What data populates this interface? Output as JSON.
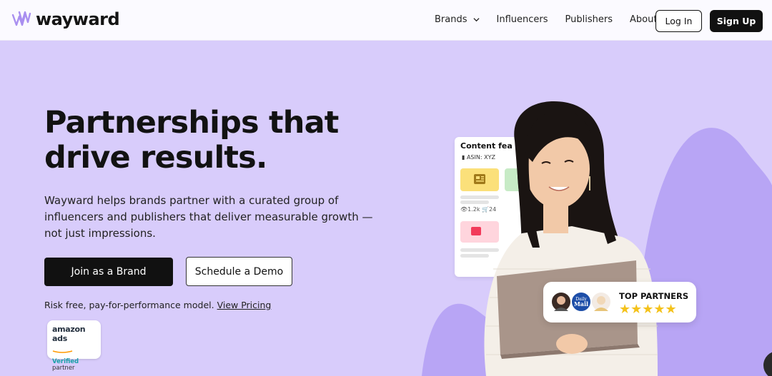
{
  "nav": {
    "logo_text": "wayward",
    "links": [
      "Brands",
      "Influencers",
      "Publishers",
      "About"
    ],
    "login_label": "Log In",
    "signup_label": "Sign Up"
  },
  "hero": {
    "headline_line1": "Partnerships that",
    "headline_line2": "drive results.",
    "subcopy": "Wayward helps brands partner with a curated group of influencers and publishers that deliver measurable growth — not just impressions.",
    "primary_cta": "Join as a Brand",
    "secondary_cta": "Schedule a Demo",
    "risk_text": "Risk free, pay-for-performance model.",
    "risk_link": "View Pricing"
  },
  "badge": {
    "title": "amazon ads",
    "verified": "Verified",
    "partner": "partner"
  },
  "content_card": {
    "title": "Content fea",
    "asin": "ASIN: XYZ",
    "views": "1.2k",
    "carts": "24"
  },
  "partners_card": {
    "title": "TOP PARTNERS",
    "stars": "★★★★★",
    "avatar_label_1": "Daily",
    "avatar_label_2": "Mail"
  },
  "colors": {
    "hero_bg": "#d8ccfb",
    "accent_purple": "#b8a5f5",
    "button_dark": "#111111",
    "star": "#f4c21b"
  },
  "icons": [
    "wayward-logo-icon",
    "chevron-down-icon",
    "document-icon",
    "eye-icon",
    "cart-icon",
    "star-icon",
    "chat-icon"
  ]
}
